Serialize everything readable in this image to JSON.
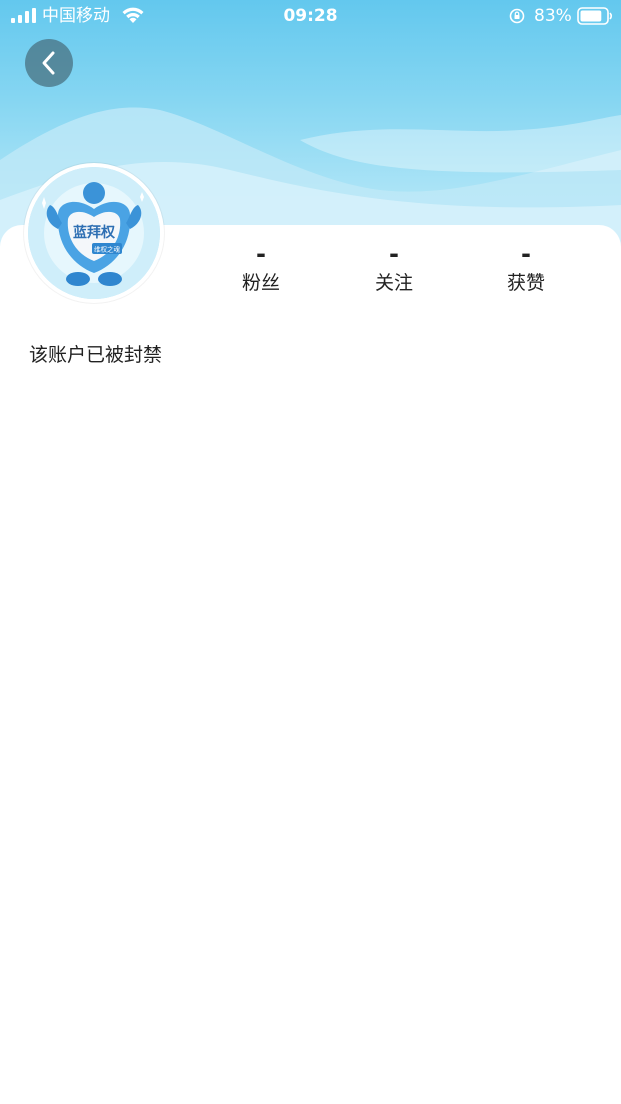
{
  "status_bar": {
    "carrier": "中国移动",
    "time": "09:28",
    "battery_percent": "83%",
    "battery_level": 0.83
  },
  "header": {
    "back_icon": "chevron-left-icon"
  },
  "profile": {
    "avatar_text": "蓝拜权",
    "avatar_subtext": "维权之魂",
    "stats": [
      {
        "value": "-",
        "label": "粉丝"
      },
      {
        "value": "-",
        "label": "关注"
      },
      {
        "value": "-",
        "label": "获赞"
      }
    ],
    "status_message": "该账户已被封禁"
  },
  "colors": {
    "banner_top": "#63c8ee",
    "banner_bottom": "#c3ecf9",
    "text": "#222222"
  }
}
